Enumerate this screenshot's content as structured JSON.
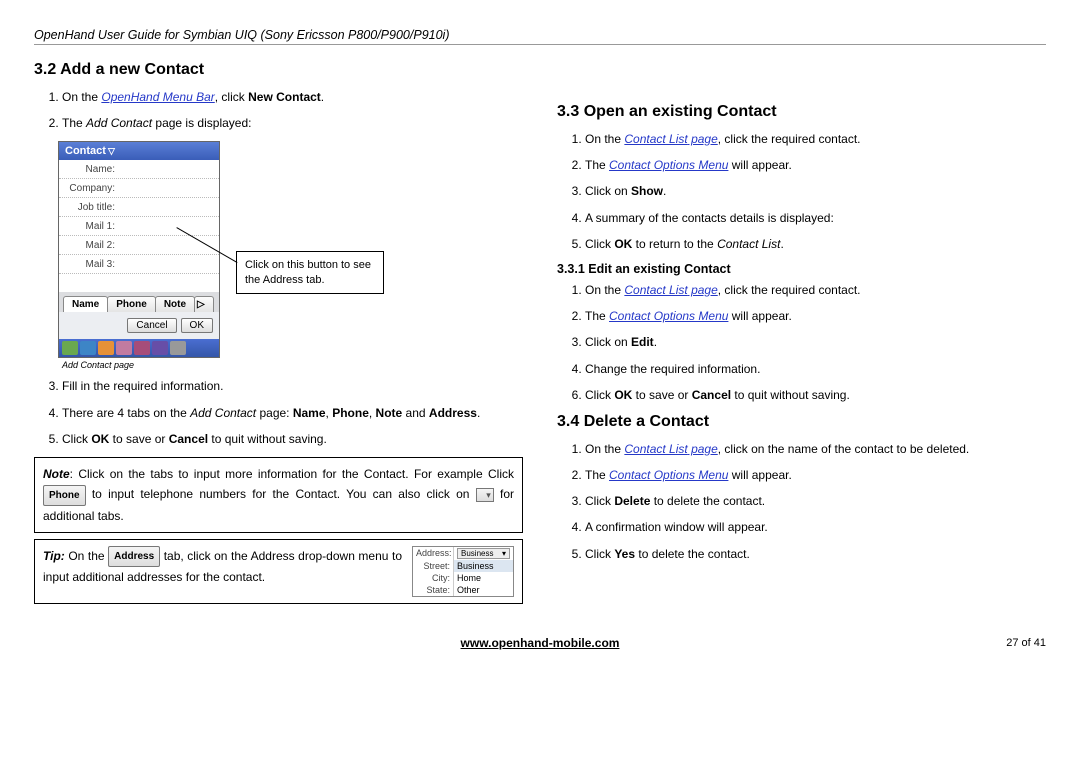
{
  "header": "OpenHand User Guide for Symbian UIQ (Sony Ericsson P800/P900/P910i)",
  "left": {
    "h_add": "3.2  Add a new Contact",
    "s1a": "On the ",
    "s1_link": "OpenHand Menu Bar",
    "s1b": ", click ",
    "s1_bold": "New Contact",
    "s1c": ".",
    "s2a": "The ",
    "s2_ital": "Add Contact",
    "s2b": " page is displayed:",
    "phone": {
      "title": "Contact",
      "rows": [
        "Name:",
        "Company:",
        "Job title:",
        "Mail 1:",
        "Mail 2:",
        "Mail 3:"
      ],
      "tabs": [
        "Name",
        "Phone",
        "Note"
      ],
      "btn_cancel": "Cancel",
      "btn_ok": "OK",
      "caption": "Add Contact page"
    },
    "callout": "Click on this button to see the Address tab.",
    "s3": "Fill in the required information.",
    "s4a": "There are 4 tabs on the ",
    "s4_ital": "Add Contact",
    "s4b": " page: ",
    "s4_t1": "Name",
    "s4_t2": "Phone",
    "s4_t3": "Note",
    "s4c": " and ",
    "s4_t4": "Address",
    "s4d": ".",
    "s5a": "Click ",
    "s5_ok": "OK",
    "s5b": " to save or ",
    "s5_cancel": "Cancel",
    "s5c": " to quit without saving.",
    "note_a": "Note",
    "note_b": ": Click on the tabs to input more information for the Contact. For example Click ",
    "note_btn": "Phone",
    "note_c": " to input telephone numbers for the Contact. You can also click on ",
    "note_d": " for additional tabs.",
    "tip_a": "Tip:",
    "tip_b": " On the ",
    "tip_btn": "Address",
    "tip_c": " tab, click on the Address drop-down menu to input additional addresses for the contact.",
    "addr": {
      "label": "Address:",
      "sel": "Business",
      "street_l": "Street:",
      "city_l": "City:",
      "state_l": "State:",
      "opts": [
        "Business",
        "Home",
        "Other"
      ]
    }
  },
  "right": {
    "h_open": "3.3  Open an existing Contact",
    "o1a": "On the ",
    "o1_link": "Contact List",
    "o1_sfx": " page",
    "o1b": ", click the required contact.",
    "o2a": "The ",
    "o2_link": "Contact Options Menu",
    "o2b": " will appear.",
    "o3a": "Click on ",
    "o3_bold": "Show",
    "o3b": ".",
    "o4": "A summary of the contacts details is displayed:",
    "o5a": "Click ",
    "o5_ok": "OK",
    "o5b": " to return to the ",
    "o5_ital": "Contact List",
    "o5c": ".",
    "h_edit": "3.3.1  Edit an existing Contact",
    "e1a": "On the ",
    "e1_link": "Contact List",
    "e1_sfx": " page",
    "e1b": ", click the required contact.",
    "e2a": "The ",
    "e2_link": "Contact Options Menu",
    "e2b": " will appear.",
    "e3a": "Click on ",
    "e3_bold": "Edit",
    "e3b": ".",
    "e4": "Change the required information.",
    "e6a": "Click ",
    "e6_ok": "OK",
    "e6b": " to save or ",
    "e6_cancel": "Cancel",
    "e6c": " to quit without saving.",
    "h_del": "3.4  Delete a Contact",
    "d1a": "On the ",
    "d1_link": "Contact List",
    "d1_sfx": " page",
    "d1b": ", click on the name of the contact to be deleted.",
    "d2a": "The ",
    "d2_link": "Contact Options Menu",
    "d2b": " will appear.",
    "d3a": "Click ",
    "d3_bold": "Delete",
    "d3b": " to delete the contact.",
    "d4": "A confirmation window will appear.",
    "d5a": "Click ",
    "d5_bold": "Yes",
    "d5b": " to delete the contact."
  },
  "footer": {
    "url": "www.openhand-mobile.com",
    "page": "27 of 41"
  }
}
